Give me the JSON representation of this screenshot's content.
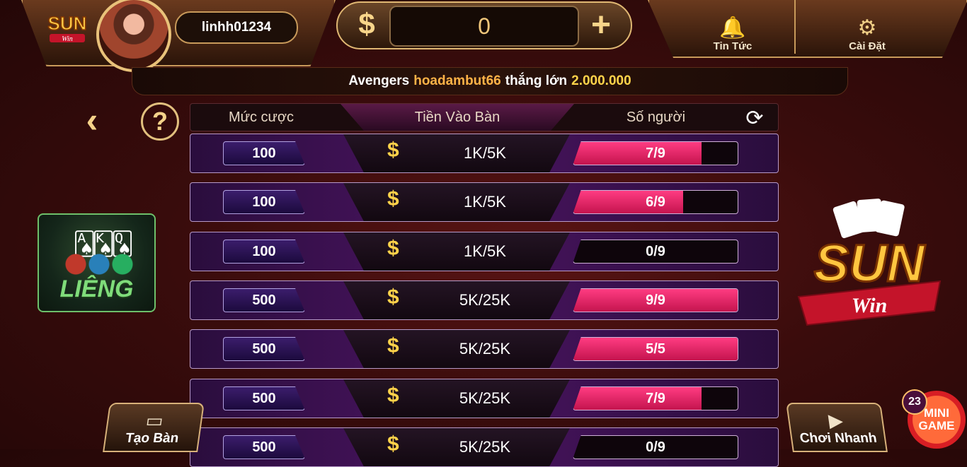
{
  "top": {
    "username": "linhh01234",
    "balance": "0",
    "dollar_symbol": "$",
    "plus_symbol": "+",
    "news_label": "Tin Tức",
    "settings_label": "Cài Đặt",
    "logo_text": "SUN",
    "logo_sub": "Win"
  },
  "announce": {
    "prefix": "Avengers",
    "player": "hoadambut66",
    "middle": "thắng lớn",
    "amount": "2.000.000"
  },
  "left": {
    "back_symbol": "‹",
    "help_symbol": "?",
    "game_name": "LIÊNG"
  },
  "table": {
    "columns": [
      "Mức cược",
      "Tiền Vào Bàn",
      "Số người"
    ],
    "currency_symbol": "$",
    "rows": [
      {
        "bet": "100",
        "entry": "1K/5K",
        "players": "7/9",
        "fill": 0.78
      },
      {
        "bet": "100",
        "entry": "1K/5K",
        "players": "6/9",
        "fill": 0.67
      },
      {
        "bet": "100",
        "entry": "1K/5K",
        "players": "0/9",
        "fill": 0
      },
      {
        "bet": "500",
        "entry": "5K/25K",
        "players": "9/9",
        "fill": 1
      },
      {
        "bet": "500",
        "entry": "5K/25K",
        "players": "5/5",
        "fill": 1
      },
      {
        "bet": "500",
        "entry": "5K/25K",
        "players": "7/9",
        "fill": 0.78
      },
      {
        "bet": "500",
        "entry": "5K/25K",
        "players": "0/9",
        "fill": 0
      }
    ]
  },
  "bottom": {
    "create_label": "Tạo Bàn",
    "quick_label": "Chơi Nhanh",
    "mini_badge": "23",
    "mini_line1": "MINI",
    "mini_line2": "GAME"
  },
  "colors": {
    "gold": "#f4d28a",
    "player_fill": "#ff3c82",
    "accent_orange": "#ffb347"
  }
}
